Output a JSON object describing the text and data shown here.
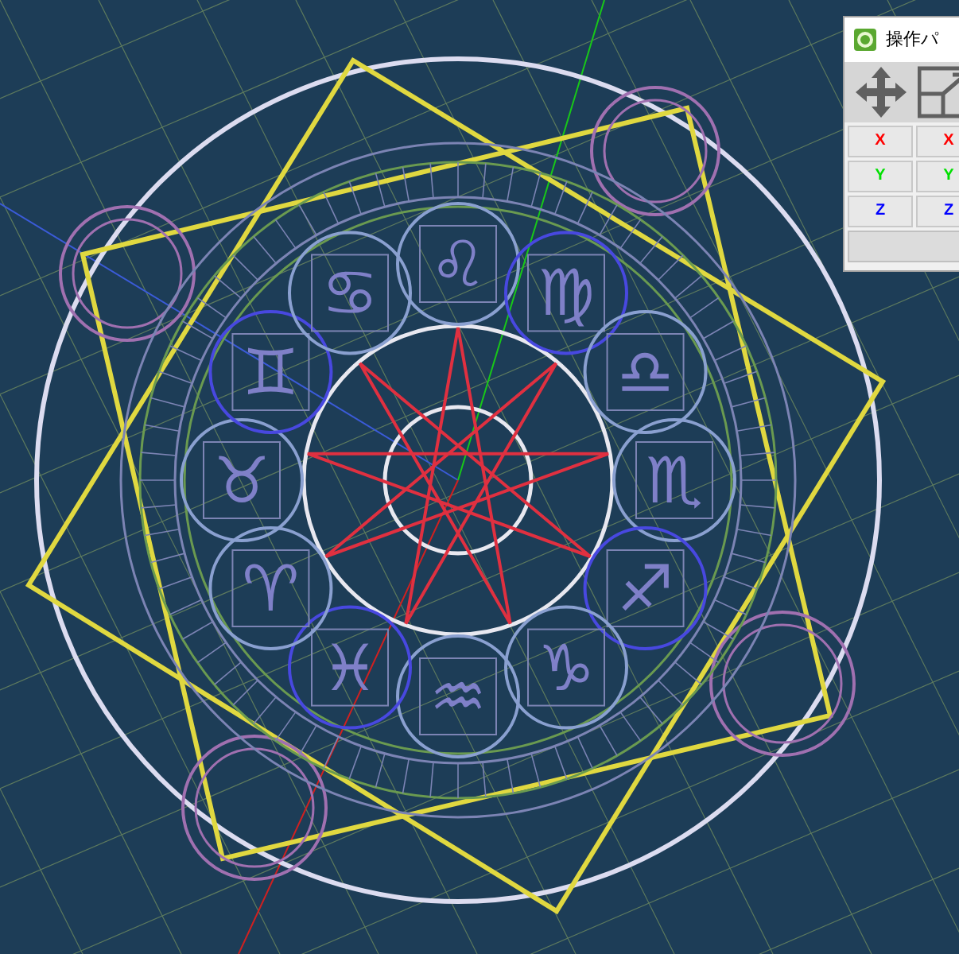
{
  "zodiac_signs": [
    "♌",
    "♍",
    "♎",
    "♏",
    "♐",
    "♑",
    "♒",
    "♓",
    "♈",
    "♉",
    "♊",
    "♋"
  ],
  "panel": {
    "title": "操作パ",
    "axis_buttons": [
      {
        "label": "X",
        "color": "#ff0000"
      },
      {
        "label": "X",
        "color": "#ff0000"
      },
      {
        "label": "Y",
        "color": "#00e000"
      },
      {
        "label": "Y",
        "color": "#00e000"
      },
      {
        "label": "Z",
        "color": "#0000ff"
      },
      {
        "label": "Z",
        "color": "#0000ff"
      }
    ]
  }
}
